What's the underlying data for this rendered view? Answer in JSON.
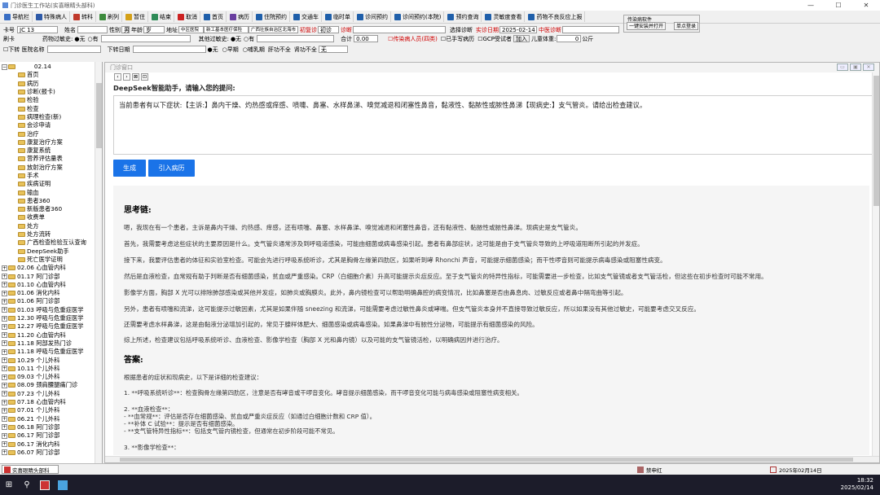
{
  "window": {
    "title": "门诊医生工作站(实喜眼睛头部科)",
    "minimize": "—",
    "maximize": "☐",
    "close": "✕"
  },
  "toolbar": [
    {
      "label": "导航栏",
      "color": "#3a6fc4"
    },
    {
      "label": "特殊病人",
      "color": "#2e5aa8"
    },
    {
      "label": "转科",
      "color": "#c0392b"
    },
    {
      "label": "刷列",
      "color": "#3d8b3d"
    },
    {
      "label": "暂住",
      "color": "#d4a017"
    },
    {
      "label": "结束",
      "color": "#2e8b57"
    },
    {
      "label": "取消",
      "color": "#cc2222"
    },
    {
      "label": "首页",
      "color": "#1f5faa"
    },
    {
      "label": "病历",
      "color": "#6a3fa0"
    },
    {
      "label": "住院预约",
      "color": "#1f5faa"
    },
    {
      "label": "交通车",
      "color": "#1f5faa"
    },
    {
      "label": "临时单",
      "color": "#1f5faa"
    },
    {
      "label": "诊间预约",
      "color": "#1f5faa"
    },
    {
      "label": "诊间预约(本院)",
      "color": "#1f5faa"
    },
    {
      "label": "预约查询",
      "color": "#1f5faa"
    },
    {
      "label": "灵敏度查看",
      "color": "#1f5faa"
    },
    {
      "label": "药物不良反应上报",
      "color": "#1f5faa"
    }
  ],
  "form": {
    "card_label": "卡号",
    "card_value": "JC  13",
    "name_label": "姓名",
    "gender_label": "性别",
    "gender_value": "男",
    "age_label": "年龄",
    "age_value": "岁",
    "address_label": "地址",
    "address_value": "中区医院",
    "unit_value": "新工基本医疗保险",
    "region_value": "广西壮族自治区北海市",
    "first_visit_label": "初复诊",
    "first_visit_value": "初诊",
    "diagnosis_label": "诊断",
    "select_diag": "选择诊断",
    "visit_date_label": "实诊日期",
    "visit_date": "2025-02-14",
    "central_diag": "中医诊断",
    "bleeding_label": "刷卡",
    "drug_allergy_label": "药物过敏史:",
    "opt_none": "无",
    "opt_yes": "有",
    "other_allergy_label": "其他过敏史:",
    "total_label": "合计",
    "total_value": "0.00",
    "infectious": "传染病人员(四类)",
    "done_hand": "已手写病历",
    "gcp": "GCP受试者",
    "add_btn": "加入",
    "child_weight_label": "儿童体重:",
    "child_weight_value": "0",
    "kg": "公斤",
    "chk_record": "下转 医院名称",
    "down_date_label": "下转日期",
    "opt_plain": "无",
    "early_pregnant": "早期",
    "breastfeeding": "哺乳期",
    "liver_insufficient": "肝功不全",
    "kidney_insufficient": "肾功不全",
    "kidney_value": "无"
  },
  "side_box": {
    "title": "传染病软件",
    "btn1": "一键安装并打开",
    "btn2": "单点登录"
  },
  "tree": {
    "root": "         02.14",
    "children": [
      "首页",
      "病历",
      "诊断(报卡)",
      "检验",
      "检查",
      "病理检查(新)",
      "会诊申请",
      "治疗",
      "康复治疗方案",
      "康复系统",
      "营养评估量表",
      "放射治疗方案",
      "手术",
      "疾病证明",
      "输血",
      "患者360",
      "新版患者360",
      "收费单",
      "处方",
      "处方流转",
      "广西检查检验互认查询",
      "DeepSeek助手",
      "死亡医学证明"
    ],
    "visits": [
      "02.06 心血管内科",
      "01.17 阿门诊部",
      "01.10 心血管内科",
      "01.06 消化内科",
      "01.06 阿门诊部",
      "01.03 呼吸与危重症医学",
      "12.30 呼吸与危重症医学",
      "12.27 呼吸与危重症医学",
      "11.20 心血管内科",
      "11.18 阿部发热门诊",
      "11.18 呼吸与危重症医学",
      "10.29 个儿外科",
      "10.11 个儿外科",
      "09.03 个儿外科",
      "08.09 颈肩腰腿痛门诊",
      "07.23 个儿外科",
      "07.18 心血管内科",
      "07.01 个儿外科",
      "06.21 个儿外科",
      "06.18 阿门诊部",
      "06.17 阿门诊部",
      "06.17 消化内科",
      "06.07 阿门诊部"
    ]
  },
  "panel": {
    "title": "门诊窗口",
    "nav": [
      "‹",
      "›",
      "⊠",
      "⊡"
    ],
    "prompt_label": "DeepSeek智能助手，请输入您的提问:",
    "question": "当前患者有以下症状:【主诉:】鼻内干燥、灼热感或痒感、喷嚏、鼻塞、水样鼻涕、嗅觉减退和闭塞性鼻音，黏液性、黏脓性或脓性鼻涕【现病史:】支气管炎。请给出检查建议。",
    "generate_btn": "生成",
    "import_btn": "引入病历"
  },
  "answer": {
    "thinking_title": "思考链:",
    "thinking": [
      "嗯，我现在有一个患者，主诉是鼻内干燥、灼热感、痒感，还有喷嚏、鼻塞、水样鼻涕、嗅觉减退和闭塞性鼻音，还有黏液性、黏脓性或脓性鼻涕。现病史是支气管炎。",
      "首先，我需要考虑这些症状的主要原因是什么。支气管炎通常涉及到呼吸道感染，可能由细菌或病毒感染引起。患者有鼻部症状，这可能是由于支气管炎导致的上呼吸道阻断所引起的并发症。",
      "接下来，我要评估患者的体征和实验室检查。可能会先进行呼吸系统听诊，尤其是胸骨左缘第四肋区，如果听到哮 Rhonchi 声音，可能提示细菌感染；而干性啰音则可能提示病毒感染或阻塞性病变。",
      "然后是血液检查，血常规有助于判断是否有细菌感染，贫血或严重感染。CRP（白细胞介素）升高可能提示炎症反应。至于支气管炎的特异性指标，可能需要进一步检查，比如支气管镜或者支气管活检，但这些在初步检查时可能不常用。",
      "影像学方面，胸部 X 光可以排除肺部感染或其他并发症，如肺炎或胸膜炎。此外，鼻内镜检查可以帮助明确鼻腔的病变情况，比如鼻塞是否由鼻息肉、过敏反应或者鼻中隔弯曲等引起。",
      "另外，患者有喷嚏和流涕，这可能提示过敏因素，尤其是如果伴随 sneezing 和流涕，可能需要考虑过敏性鼻炎或哮喘。但支气管炎本身并不直接导致过敏反应，所以如果没有其他过敏史，可能要考虑交叉反应。",
      "还需要考虑水样鼻涕，这是由黏液分泌增加引起的，常见于腺样体肥大、细菌感染或病毒感染。如果鼻涕中有脓性分泌物，可能提示有细菌感染的风险。",
      "综上所述，检查建议包括呼吸系统听诊、血液检查、影像学检查（胸部 X 光和鼻内镜）以及可能的支气管镜活检，以明确病因并进行治疗。"
    ],
    "answer_title": "答案:",
    "answer_intro": "根据患者的症状和现病史，以下是详细的检查建议：",
    "lines": [
      "1. **呼吸系统听诊**：检查胸骨左缘第四肋区，注意是否有哮音或干啰音变化。哮音提示细菌感染，而干啰音变化可能与病毒感染或阻塞性病变相关。",
      "",
      "2. **血液检查**：",
      "   - **血常规**：评估是否存在细菌感染、贫血或严重炎症反应（如通过白细胞计数和 CRP 值）。",
      "   - **补体 C 试验**：提示是否有细菌感染。",
      "   - **支气管特异性指标**：包括支气管内镜检查，但通常在初步阶段可能不常见。",
      "",
      "3. **影像学检查**："
    ]
  },
  "statusbar": {
    "app": "实喜眼睛头部科",
    "user": "禁申红",
    "date": "2025年02月14日"
  },
  "taskbar": {
    "time": "18:32",
    "date": "2025/02/14"
  }
}
